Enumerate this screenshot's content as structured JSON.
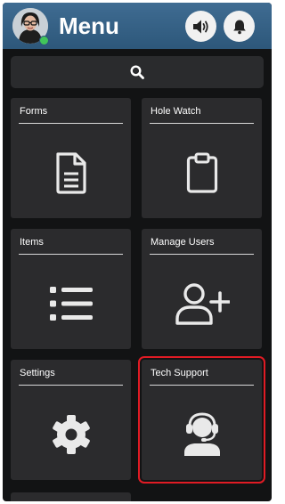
{
  "header": {
    "title": "Menu",
    "avatar": "user-avatar-photo",
    "status_color": "#41c55a",
    "sound_icon": "speaker-icon",
    "notification_icon": "bell-icon"
  },
  "search": {
    "icon": "search-icon"
  },
  "tiles": [
    {
      "label": "Forms",
      "icon": "document-icon"
    },
    {
      "label": "Hole Watch",
      "icon": "clipboard-icon"
    },
    {
      "label": "Items",
      "icon": "list-icon"
    },
    {
      "label": "Manage Users",
      "icon": "add-user-icon"
    },
    {
      "label": "Settings",
      "icon": "gear-icon"
    },
    {
      "label": "Tech Support",
      "icon": "headset-support-icon",
      "highlighted": true
    }
  ],
  "colors": {
    "header": "#3a6589",
    "background": "#121314",
    "tile": "#2b2b2d",
    "highlight": "#e01b24"
  }
}
